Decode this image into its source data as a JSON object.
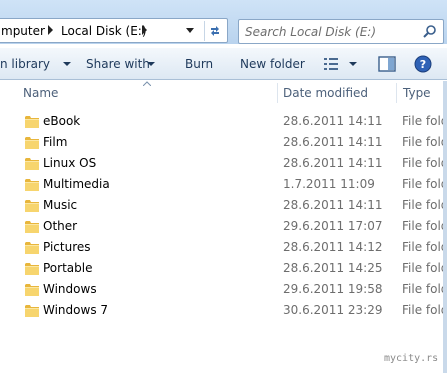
{
  "address": {
    "crumbs": [
      "mputer",
      "Local Disk (E:)"
    ]
  },
  "search": {
    "placeholder": "Search Local Disk (E:)"
  },
  "toolbar": {
    "include_label": "n library",
    "share_label": "Share with",
    "burn_label": "Burn",
    "new_folder_label": "New folder"
  },
  "columns": {
    "name": "Name",
    "date": "Date modified",
    "type": "Type"
  },
  "files": [
    {
      "name": "eBook",
      "date": "28.6.2011 14:11",
      "type": "File fold"
    },
    {
      "name": "Film",
      "date": "28.6.2011 14:11",
      "type": "File fold"
    },
    {
      "name": "Linux OS",
      "date": "28.6.2011 14:11",
      "type": "File fold"
    },
    {
      "name": "Multimedia",
      "date": "1.7.2011 11:09",
      "type": "File fold"
    },
    {
      "name": "Music",
      "date": "28.6.2011 14:11",
      "type": "File fold"
    },
    {
      "name": "Other",
      "date": "29.6.2011 17:07",
      "type": "File fold"
    },
    {
      "name": "Pictures",
      "date": "28.6.2011 14:12",
      "type": "File fold"
    },
    {
      "name": "Portable",
      "date": "28.6.2011 14:25",
      "type": "File fold"
    },
    {
      "name": "Windows",
      "date": "29.6.2011 19:58",
      "type": "File fold"
    },
    {
      "name": "Windows 7",
      "date": "30.6.2011 23:29",
      "type": "File fold"
    }
  ],
  "watermark": "mycity.rs",
  "colors": {
    "toolbar_text": "#1e395b",
    "header_text": "#4c607a",
    "secondary_text": "#6d6d6d",
    "folder_yellow": "#f2c84b"
  }
}
